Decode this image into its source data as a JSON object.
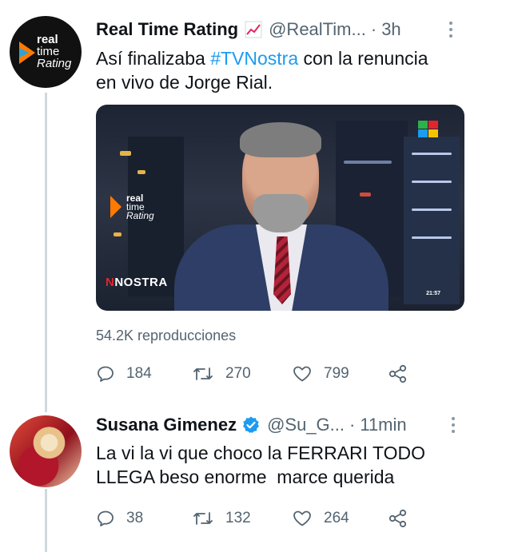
{
  "tweets": [
    {
      "display_name": "Real Time Rating",
      "name_emoji": "📈",
      "handle": "@RealTim...",
      "separator": "·",
      "time": "3h",
      "text_before": "Así finalizaba ",
      "hashtag": "#TVNostra",
      "text_after_line1": " con la renuncia",
      "text_line2": "en vivo de Jorge Rial.",
      "avatar_text": [
        "real",
        "time",
        "Rating"
      ],
      "media": {
        "logo_text": [
          "real",
          "time",
          "Rating"
        ],
        "show_label_prefix": "N",
        "show_label": "NOSTRA",
        "clock": "21:57"
      },
      "views": "54.2K reproducciones",
      "replies": "184",
      "retweets": "270",
      "likes": "799"
    },
    {
      "display_name": "Susana Gimenez",
      "verified": true,
      "handle": "@Su_G...",
      "separator": "·",
      "time": "11min",
      "text_line1": "La vi la vi que choco la FERRARI TODO",
      "text_line2": "LLEGA beso enorme  marce querida",
      "replies": "38",
      "retweets": "132",
      "likes": "264"
    }
  ],
  "colors": {
    "accent": "#1d9bf0",
    "muted": "#536471",
    "text": "#0f1419"
  },
  "icons": [
    "more-icon",
    "reply-icon",
    "retweet-icon",
    "like-icon",
    "share-icon",
    "verified-icon",
    "chart-emoji-icon"
  ]
}
